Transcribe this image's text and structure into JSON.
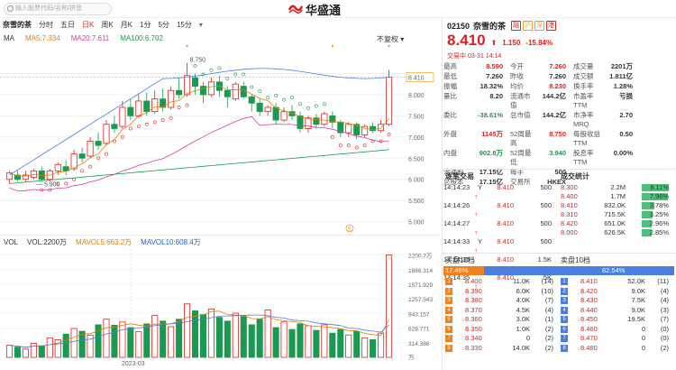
{
  "search": {
    "placeholder": "输入股票代码/名称/拼音"
  },
  "logo": {
    "text": "华盛通"
  },
  "toolbar": {
    "stock_name": "奈雪的茶",
    "periods": [
      "分时",
      "五日",
      "日K",
      "周K",
      "月K",
      "1分",
      "5分",
      "15分"
    ],
    "active_period": "日K"
  },
  "ma": {
    "label": "MA",
    "ma5": "MA5:7.334",
    "ma20": "MA20:7.611",
    "ma100": "MA100:6.702",
    "adjust": "不复权",
    "colors": {
      "ma5": "#e08000",
      "ma20": "#d040a0",
      "ma100": "#1a9a50"
    }
  },
  "price_axis": {
    "ticks": [
      "8.410",
      "8.000",
      "7.500",
      "7.000",
      "6.500",
      "6.000",
      "5.500",
      "5.000"
    ],
    "current": "8.410"
  },
  "annotations": {
    "high": "8.750",
    "low": "5.900",
    "marker": "E"
  },
  "volume": {
    "title": "VOL",
    "vol": "VOL:2200万",
    "mavol5": "MAVOL5:663.2万",
    "mavol10": "MAVOL10:608.4万",
    "ticks": [
      "2200.7万",
      "1886.314",
      "1571.929",
      "1257.543",
      "943.157",
      "628.771",
      "314.386",
      "万"
    ],
    "date_label": "2023-03"
  },
  "quote": {
    "code": "02150",
    "name": "奈雪的茶",
    "tags": [
      "融",
      "沪",
      "深",
      "港"
    ],
    "price": "8.410",
    "change": "1.150",
    "change_pct": "-15.84%",
    "status": "交易中 03-31 14:14",
    "fields": [
      [
        "最高",
        "8.590",
        "今开",
        "7.260",
        "成交量",
        "2201万"
      ],
      [
        "最低",
        "7.260",
        "昨收",
        "7.260",
        "成交额",
        "1.811亿"
      ],
      [
        "振幅",
        "18.32%",
        "均价",
        "8.230",
        "换手率",
        "1.28%"
      ],
      [
        "量比",
        "8.20",
        "流通市值",
        "144.2亿",
        "市盈率TTM",
        "亏损"
      ],
      [
        "委比",
        "-38.61%",
        "总市值",
        "144.2亿",
        "市净率MRQ",
        "2.70"
      ],
      [
        "外盘",
        "1145万",
        "52周最高",
        "8.750",
        "每股收益TTM",
        "0.50"
      ],
      [
        "内盘",
        "902.8万",
        "52周最低",
        "3.940",
        "股息率TTM",
        "0.00%"
      ],
      [
        "流通股",
        "17.15亿",
        "每手",
        "500",
        "",
        ""
      ],
      [
        "总股本",
        "17.15亿",
        "交易所",
        "HKEX",
        "",
        ""
      ]
    ]
  },
  "trades": {
    "title": "逐笔交易",
    "rows": [
      [
        "14:14:23",
        "Y",
        "8.410",
        "500",
        "↑"
      ],
      [
        "14:14:26",
        "",
        "8.410",
        "500",
        "↑"
      ],
      [
        "14:14:27",
        "",
        "8.410",
        "500",
        "↑"
      ],
      [
        "14:14:33",
        "Y",
        "8.410",
        "500",
        "↑"
      ],
      [
        "14:14:35",
        "",
        "8.410",
        "1.5K",
        "↑"
      ],
      [
        "14:14:35",
        "",
        "8.410",
        "5K",
        "↑"
      ]
    ]
  },
  "stats": {
    "title": "成交统计",
    "rows": [
      [
        "8.300",
        "2.2M",
        "8.11%"
      ],
      [
        "8.400",
        "1.7M",
        "7.96%"
      ],
      [
        "8.410",
        "832.0K",
        "3.78%"
      ],
      [
        "8.310",
        "715.5K",
        "3.25%"
      ],
      [
        "8.420",
        "651.0K",
        "2.96%"
      ],
      [
        "8.000",
        "626.5K",
        "2.85%"
      ]
    ],
    "fill": [
      1.0,
      0.98,
      0.47,
      0.4,
      0.37,
      0.35
    ]
  },
  "orderbook": {
    "bid_title": "买盘10档",
    "ask_title": "卖盘10档",
    "bid_pct": "17.46%",
    "ask_pct": "82.54%",
    "bid_ratio": 0.1746,
    "bids": [
      [
        "1",
        "8.400",
        "11.0K",
        "(14)"
      ],
      [
        "2",
        "8.390",
        "6.0K",
        "(10)"
      ],
      [
        "3",
        "8.380",
        "4.0K",
        "(7)"
      ],
      [
        "4",
        "8.370",
        "4.5K",
        "(4)"
      ],
      [
        "5",
        "8.360",
        "3.0K",
        "(1)"
      ],
      [
        "6",
        "8.350",
        "1.0K",
        "(2)"
      ],
      [
        "7",
        "8.340",
        "0",
        "(2)"
      ],
      [
        "8",
        "8.330",
        "14.0K",
        "(2)"
      ]
    ],
    "asks": [
      [
        "1",
        "8.410",
        "52.0K",
        "(11)"
      ],
      [
        "2",
        "8.420",
        "9.0K",
        "(4)"
      ],
      [
        "3",
        "8.430",
        "7.5K",
        "(4)"
      ],
      [
        "4",
        "8.440",
        "9.0K",
        "(3)"
      ],
      [
        "5",
        "8.450",
        "19.5K",
        "(7)"
      ],
      [
        "6",
        "8.460",
        "0",
        "(0)"
      ],
      [
        "7",
        "8.470",
        "0",
        "(0)"
      ],
      [
        "8",
        "8.480",
        "0",
        "(2)"
      ]
    ]
  }
}
